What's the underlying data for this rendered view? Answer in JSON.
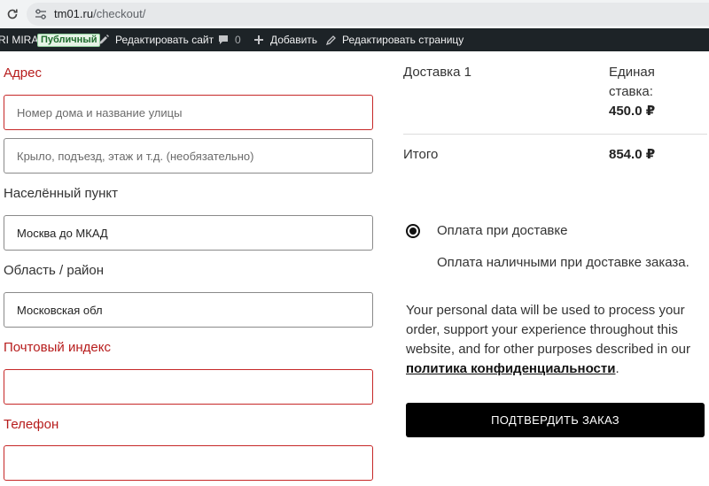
{
  "browser": {
    "url_host": "tm01.ru",
    "url_path": "/checkout/"
  },
  "admin_bar": {
    "site_name": "RI MIRA",
    "status_badge": "Публичный",
    "edit_site": "Редактировать сайт",
    "comments_count": "0",
    "add_new": "Добавить",
    "edit_page": "Редактировать страницу"
  },
  "billing": {
    "address_label": "Адрес",
    "address_1_placeholder": "Номер дома и название улицы",
    "address_2_placeholder": "Крыло, подъезд, этаж и т.д. (необязательно)",
    "city_label": "Населённый пункт",
    "city_value": "Москва до МКАД",
    "state_label": "Область / район",
    "state_value": "Московская обл",
    "postcode_label": "Почтовый индекс",
    "postcode_value": "",
    "phone_label": "Телефон",
    "phone_value": ""
  },
  "order_review": {
    "shipping_label": "Доставка 1",
    "shipping_method_line1": "Единая",
    "shipping_method_line2": "ставка:",
    "shipping_price": "450.0 ₽",
    "total_label": "Итого",
    "total_value": "854.0 ₽"
  },
  "payment": {
    "method_label": "Оплата при доставке",
    "method_description": "Оплата наличными при доставке заказа.",
    "privacy_text": "Your personal data will be used to process your order, support your experience throughout this website, and for other purposes described in our",
    "privacy_link": "политика конфиденциальности",
    "privacy_end": ".",
    "place_order_label": "ПОДТВЕРДИТЬ ЗАКАЗ"
  },
  "colors": {
    "required_label": "#b71c1c",
    "error_border": "#c62828",
    "admin_bar_bg": "#1d2327",
    "button_bg": "#000000"
  }
}
